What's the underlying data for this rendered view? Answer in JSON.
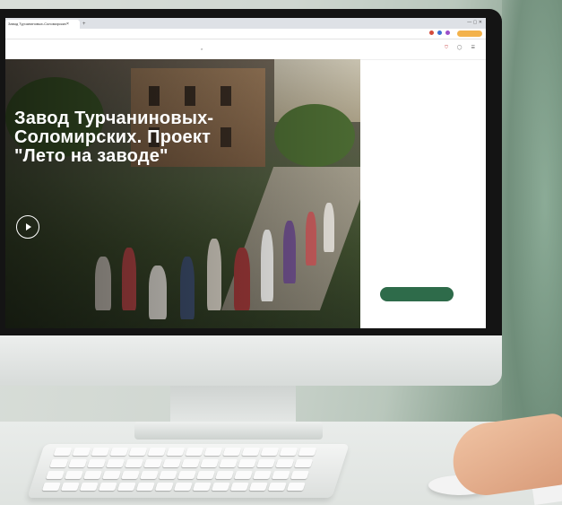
{
  "browser": {
    "tab_title": "Завод Турчаниновых-Соломирских",
    "new_tab_symbol": "+",
    "url": "",
    "window_controls": "— ▢ ✕",
    "extension_label": ""
  },
  "site": {
    "logo_text": "",
    "nav": [
      "",
      "",
      "",
      "",
      ""
    ],
    "icons": [
      "search-icon",
      "cart-icon",
      "user-icon",
      "menu-icon"
    ]
  },
  "hero": {
    "title": "Завод Турчаниновых-Соломирских. Проект \"Лето на заводе\"",
    "subtitle": "",
    "play_icon": "play-icon"
  },
  "info": {
    "items": [
      {
        "label": "",
        "value": ""
      },
      {
        "label": "",
        "value": ""
      },
      {
        "label": "",
        "value": ""
      },
      {
        "label": "",
        "value": ""
      },
      {
        "label": "",
        "value": ""
      },
      {
        "label": "",
        "value": ""
      },
      {
        "label": "",
        "value": ""
      },
      {
        "label": "",
        "value": ""
      },
      {
        "label": "",
        "value": ""
      }
    ],
    "cta_label": ""
  },
  "colors": {
    "accent": "#2e6b4a",
    "cart": "#c94a4a"
  }
}
